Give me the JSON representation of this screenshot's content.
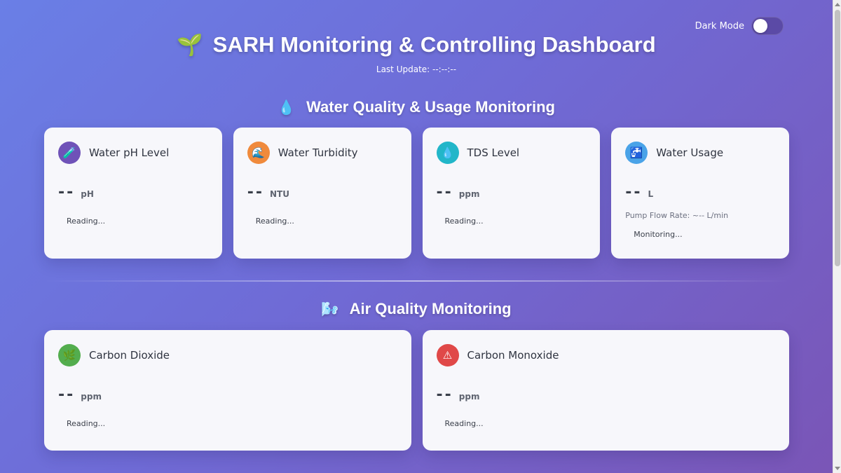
{
  "theme_toggle": {
    "label": "Dark Mode"
  },
  "header": {
    "title": "SARH Monitoring & Controlling Dashboard",
    "last_update_label": "Last Update: --:--:--"
  },
  "sections": {
    "water": {
      "title": "Water Quality & Usage Monitoring",
      "cards": [
        {
          "title": "Water pH Level",
          "value": "--",
          "unit": "pH",
          "status": "Reading...",
          "icon": "test-tube-icon",
          "icon_color": "#6f52b8"
        },
        {
          "title": "Water Turbidity",
          "value": "--",
          "unit": "NTU",
          "status": "Reading...",
          "icon": "wave-icon",
          "icon_color": "#f08a3c"
        },
        {
          "title": "TDS Level",
          "value": "--",
          "unit": "ppm",
          "status": "Reading...",
          "icon": "droplet-icon",
          "icon_color": "#22b6c9"
        },
        {
          "title": "Water Usage",
          "value": "--",
          "unit": "L",
          "sub_info": "Pump Flow Rate: ~-- L/min",
          "status": "Monitoring...",
          "icon": "faucet-icon",
          "icon_color": "#4aa3e8"
        }
      ]
    },
    "air": {
      "title": "Air Quality Monitoring",
      "cards": [
        {
          "title": "Carbon Dioxide",
          "value": "--",
          "unit": "ppm",
          "status": "Reading...",
          "icon": "leaf-icon",
          "icon_color": "#53ad4e"
        },
        {
          "title": "Carbon Monoxide",
          "value": "--",
          "unit": "ppm",
          "status": "Reading...",
          "icon": "warning-icon",
          "icon_color": "#e04848"
        }
      ]
    }
  }
}
